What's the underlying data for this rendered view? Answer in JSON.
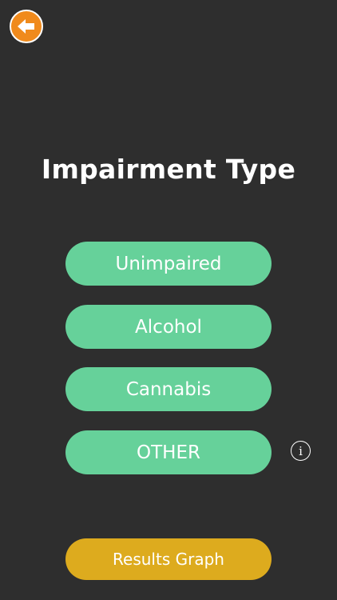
{
  "header": {
    "back_icon": "arrow-left-icon",
    "back_color": "#f08a1c"
  },
  "title": "Impairment Type",
  "options": [
    {
      "label": "Unimpaired"
    },
    {
      "label": "Alcohol"
    },
    {
      "label": "Cannabis"
    },
    {
      "label": "OTHER"
    }
  ],
  "info": {
    "icon": "info-icon",
    "glyph": "i"
  },
  "results": {
    "label": "Results Graph"
  },
  "colors": {
    "background": "#2e2e2e",
    "option_green": "#66d19a",
    "results_gold": "#ddab1e",
    "text": "#ffffff"
  }
}
